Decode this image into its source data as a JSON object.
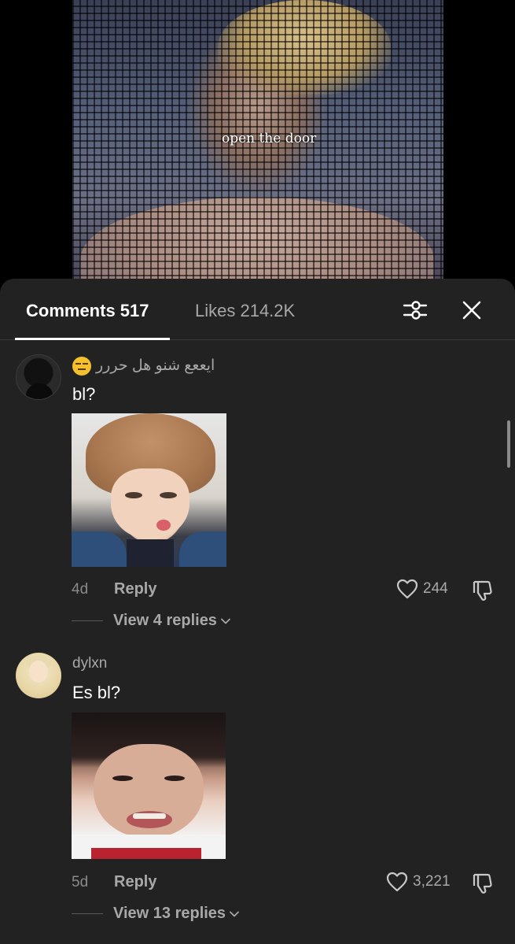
{
  "video": {
    "caption": "open the door"
  },
  "tabs": {
    "comments_label": "Comments 517",
    "likes_label": "Likes 214.2K",
    "filter_icon": "filter-sliders-icon",
    "close_icon": "close-icon"
  },
  "comments": [
    {
      "username": "ايععع شنو هل حررر",
      "username_emoji": "expressionless-face-emoji",
      "text": "bl?",
      "age": "4d",
      "reply_label": "Reply",
      "likes": "244",
      "view_replies": "View 4 replies"
    },
    {
      "username": "dylxn",
      "text": "Es bl?",
      "age": "5d",
      "reply_label": "Reply",
      "likes": "3,221",
      "view_replies": "View 13 replies"
    }
  ],
  "colors": {
    "sheet_background": "#222222",
    "primary_text": "#ffffff",
    "secondary_text": "#a8a8a8"
  }
}
